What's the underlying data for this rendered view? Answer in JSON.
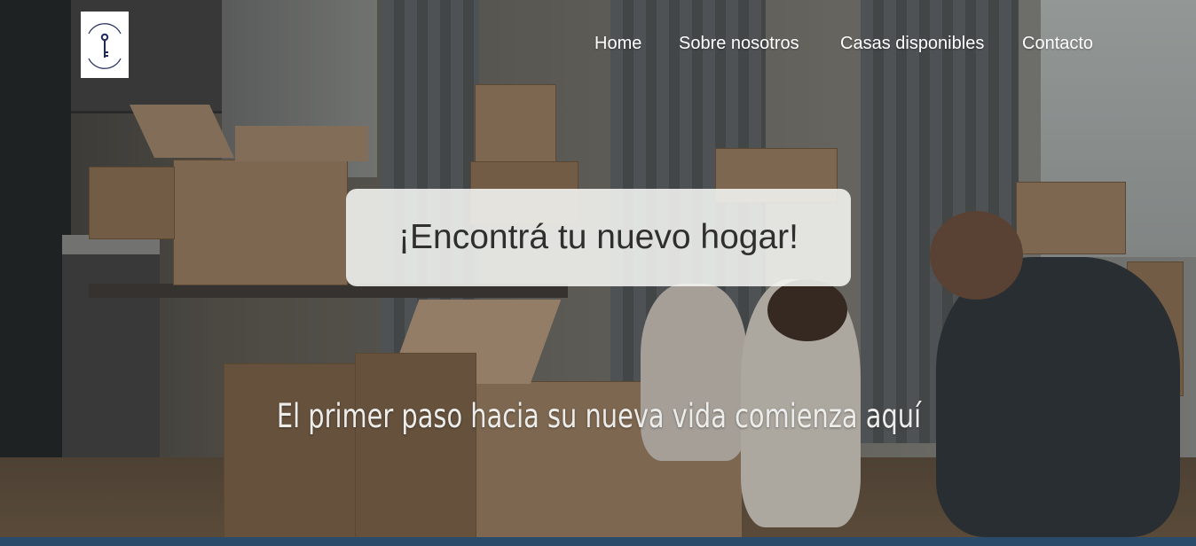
{
  "header": {
    "logo_name": "key-logo",
    "nav": [
      {
        "label": "Home"
      },
      {
        "label": "Sobre nosotros"
      },
      {
        "label": "Casas disponibles"
      },
      {
        "label": "Contacto"
      }
    ]
  },
  "hero": {
    "headline": "¡Encontrá tu nuevo hogar!",
    "subtitle": "El primer paso hacia su nueva vida comienza aquí",
    "background_image": "family-moving-boxes"
  },
  "colors": {
    "nav_text": "#ffffff",
    "headline_box": "#f5f6f2",
    "headline_text": "#2f302d",
    "bottom_bar": "#2b4b6a",
    "logo_key": "#1f2a5c"
  }
}
